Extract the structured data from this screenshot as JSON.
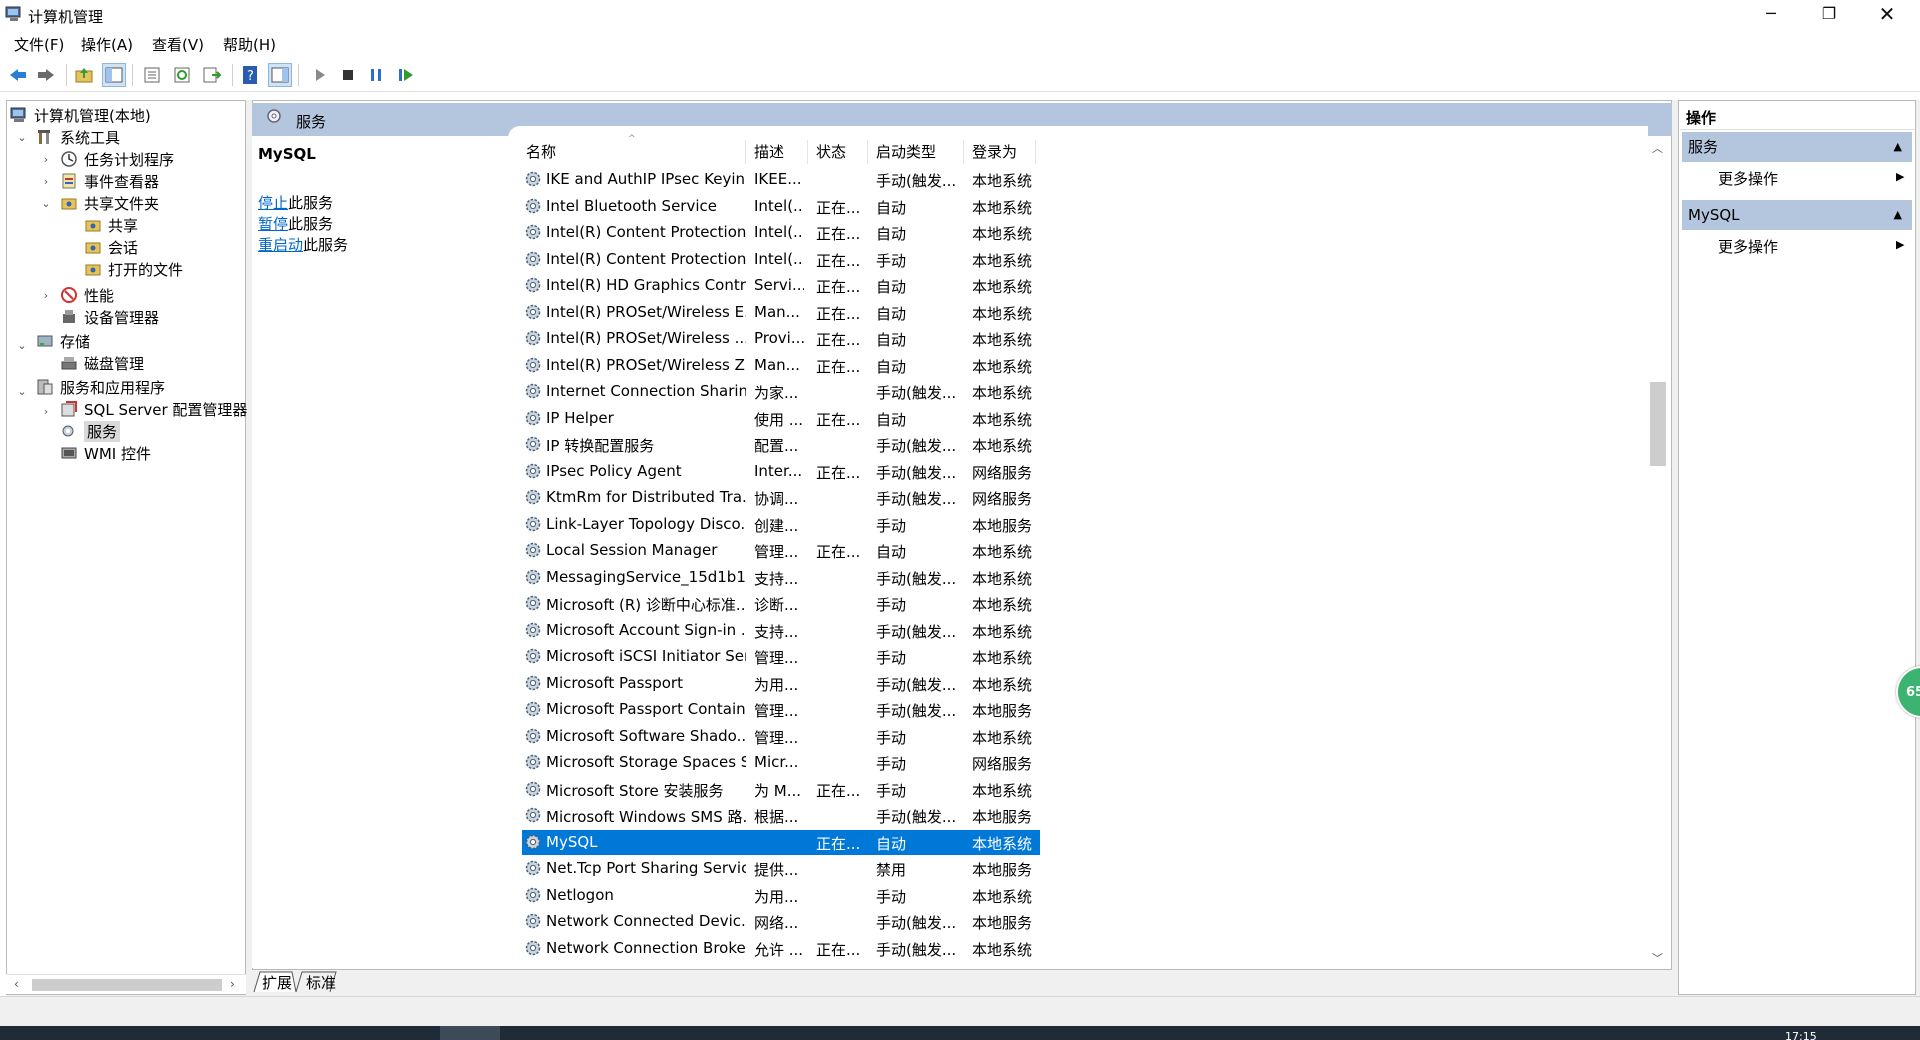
{
  "window": {
    "title": "计算机管理",
    "minimize": "─",
    "maximize": "❐",
    "close": "✕"
  },
  "menu": [
    "文件(F)",
    "操作(A)",
    "查看(V)",
    "帮助(H)"
  ],
  "tree": {
    "root": "计算机管理(本地)",
    "system_tools": "系统工具",
    "task_scheduler": "任务计划程序",
    "event_viewer": "事件查看器",
    "shared_folders": "共享文件夹",
    "shares": "共享",
    "sessions": "会话",
    "open_files": "打开的文件",
    "performance": "性能",
    "device_manager": "设备管理器",
    "storage": "存储",
    "disk_management": "磁盘管理",
    "services_apps": "服务和应用程序",
    "sql_config": "SQL Server 配置管理器",
    "services": "服务",
    "wmi": "WMI 控件"
  },
  "center": {
    "header": "服务",
    "selected_service": "MySQL",
    "links": [
      {
        "link": "停止",
        "rest": "此服务"
      },
      {
        "link": "暂停",
        "rest": "此服务"
      },
      {
        "link": "重启动",
        "rest": "此服务"
      }
    ],
    "columns": {
      "name": "名称",
      "desc": "描述",
      "status": "状态",
      "startup": "启动类型",
      "logon": "登录为"
    },
    "tabs": {
      "extended": "扩展",
      "standard": "标准"
    }
  },
  "services": [
    {
      "name": "IKE and AuthIP IPsec Keyin...",
      "desc": "IKEE...",
      "status": "",
      "startup": "手动(触发...",
      "logon": "本地系统"
    },
    {
      "name": "Intel Bluetooth Service",
      "desc": "Intel(...",
      "status": "正在...",
      "startup": "自动",
      "logon": "本地系统"
    },
    {
      "name": "Intel(R) Content Protection...",
      "desc": "Intel(...",
      "status": "正在...",
      "startup": "自动",
      "logon": "本地系统"
    },
    {
      "name": "Intel(R) Content Protection...",
      "desc": "Intel(...",
      "status": "正在...",
      "startup": "手动",
      "logon": "本地系统"
    },
    {
      "name": "Intel(R) HD Graphics Contr...",
      "desc": "Servi...",
      "status": "正在...",
      "startup": "自动",
      "logon": "本地系统"
    },
    {
      "name": "Intel(R) PROSet/Wireless E...",
      "desc": "Man...",
      "status": "正在...",
      "startup": "自动",
      "logon": "本地系统"
    },
    {
      "name": "Intel(R) PROSet/Wireless ...",
      "desc": "Provi...",
      "status": "正在...",
      "startup": "自动",
      "logon": "本地系统"
    },
    {
      "name": "Intel(R) PROSet/Wireless Z...",
      "desc": "Man...",
      "status": "正在...",
      "startup": "自动",
      "logon": "本地系统"
    },
    {
      "name": "Internet Connection Sharin...",
      "desc": "为家...",
      "status": "",
      "startup": "手动(触发...",
      "logon": "本地系统"
    },
    {
      "name": "IP Helper",
      "desc": "使用 ...",
      "status": "正在...",
      "startup": "自动",
      "logon": "本地系统"
    },
    {
      "name": "IP 转换配置服务",
      "desc": "配置...",
      "status": "",
      "startup": "手动(触发...",
      "logon": "本地系统"
    },
    {
      "name": "IPsec Policy Agent",
      "desc": "Inter...",
      "status": "正在...",
      "startup": "手动(触发...",
      "logon": "网络服务"
    },
    {
      "name": "KtmRm for Distributed Tra...",
      "desc": "协调...",
      "status": "",
      "startup": "手动(触发...",
      "logon": "网络服务"
    },
    {
      "name": "Link-Layer Topology Disco...",
      "desc": "创建...",
      "status": "",
      "startup": "手动",
      "logon": "本地服务"
    },
    {
      "name": "Local Session Manager",
      "desc": "管理...",
      "status": "正在...",
      "startup": "自动",
      "logon": "本地系统"
    },
    {
      "name": "MessagingService_15d1b1",
      "desc": "支持...",
      "status": "",
      "startup": "手动(触发...",
      "logon": "本地系统"
    },
    {
      "name": "Microsoft (R) 诊断中心标准...",
      "desc": "诊断...",
      "status": "",
      "startup": "手动",
      "logon": "本地系统"
    },
    {
      "name": "Microsoft Account Sign-in ...",
      "desc": "支持...",
      "status": "",
      "startup": "手动(触发...",
      "logon": "本地系统"
    },
    {
      "name": "Microsoft iSCSI Initiator Ser...",
      "desc": "管理...",
      "status": "",
      "startup": "手动",
      "logon": "本地系统"
    },
    {
      "name": "Microsoft Passport",
      "desc": "为用...",
      "status": "",
      "startup": "手动(触发...",
      "logon": "本地系统"
    },
    {
      "name": "Microsoft Passport Container",
      "desc": "管理...",
      "status": "",
      "startup": "手动(触发...",
      "logon": "本地服务"
    },
    {
      "name": "Microsoft Software Shado...",
      "desc": "管理...",
      "status": "",
      "startup": "手动",
      "logon": "本地系统"
    },
    {
      "name": "Microsoft Storage Spaces S...",
      "desc": "Micr...",
      "status": "",
      "startup": "手动",
      "logon": "网络服务"
    },
    {
      "name": "Microsoft Store 安装服务",
      "desc": "为 M...",
      "status": "正在...",
      "startup": "手动",
      "logon": "本地系统"
    },
    {
      "name": "Microsoft Windows SMS 路...",
      "desc": "根据...",
      "status": "",
      "startup": "手动(触发...",
      "logon": "本地服务"
    },
    {
      "name": "MySQL",
      "desc": "",
      "status": "正在...",
      "startup": "自动",
      "logon": "本地系统",
      "selected": true
    },
    {
      "name": "Net.Tcp Port Sharing Service",
      "desc": "提供...",
      "status": "",
      "startup": "禁用",
      "logon": "本地服务"
    },
    {
      "name": "Netlogon",
      "desc": "为用...",
      "status": "",
      "startup": "手动",
      "logon": "本地系统"
    },
    {
      "name": "Network Connected Devic...",
      "desc": "网络...",
      "status": "",
      "startup": "手动(触发...",
      "logon": "本地服务"
    },
    {
      "name": "Network Connection Broker",
      "desc": "允许 ...",
      "status": "正在...",
      "startup": "手动(触发...",
      "logon": "本地系统"
    }
  ],
  "actions": {
    "title": "操作",
    "section1": "服务",
    "section1_item": "更多操作",
    "section2": "MySQL",
    "section2_item": "更多操作"
  },
  "badge": "65",
  "clock": "17:15",
  "colors": {
    "selection": "#0078d7",
    "header_blue": "#b3c6de",
    "link": "#0066cc"
  }
}
